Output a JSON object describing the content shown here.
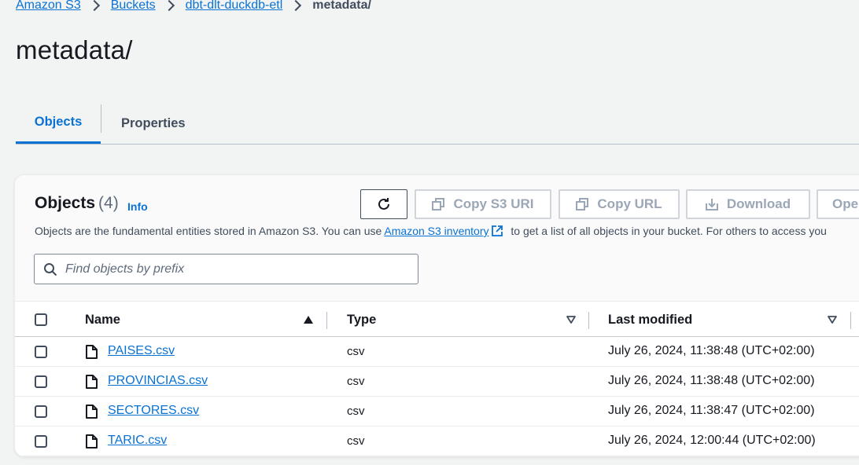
{
  "breadcrumb": {
    "items": [
      "Amazon S3",
      "Buckets",
      "dbt-dlt-duckdb-etl"
    ],
    "current": "metadata/"
  },
  "page_title": "metadata/",
  "tabs": [
    {
      "label": "Objects",
      "active": true
    },
    {
      "label": "Properties",
      "active": false
    }
  ],
  "objects_panel": {
    "title": "Objects",
    "count": "(4)",
    "info_label": "Info",
    "description_prefix": "Objects are the fundamental entities stored in Amazon S3. You can use ",
    "description_link": "Amazon S3 inventory",
    "description_suffix": " to get a list of all objects in your bucket. For others to access you",
    "buttons": {
      "copy_uri": "Copy S3 URI",
      "copy_url": "Copy URL",
      "download": "Download",
      "open": "Ope"
    },
    "search_placeholder": "Find objects by prefix"
  },
  "table": {
    "columns": [
      "Name",
      "Type",
      "Last modified"
    ],
    "rows": [
      {
        "name": "PAISES.csv",
        "type": "csv",
        "last_modified": "July 26, 2024, 11:38:48 (UTC+02:00)"
      },
      {
        "name": "PROVINCIAS.csv",
        "type": "csv",
        "last_modified": "July 26, 2024, 11:38:48 (UTC+02:00)"
      },
      {
        "name": "SECTORES.csv",
        "type": "csv",
        "last_modified": "July 26, 2024, 11:38:47 (UTC+02:00)"
      },
      {
        "name": "TARIC.csv",
        "type": "csv",
        "last_modified": "July 26, 2024, 12:00:44 (UTC+02:00)"
      }
    ]
  },
  "colors": {
    "link": "#0972d3",
    "text": "#16191f",
    "muted": "#414d5c",
    "disabled": "#9ba7b6",
    "background": "#f2f3f3"
  }
}
